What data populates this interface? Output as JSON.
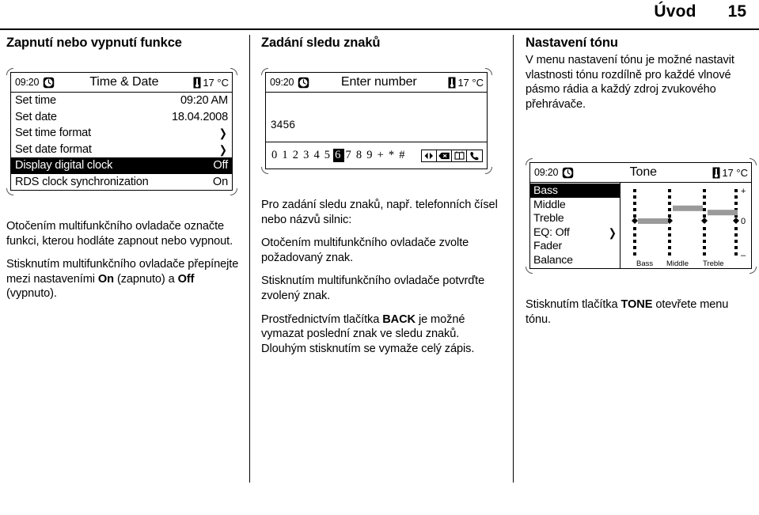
{
  "header": {
    "chapter": "Úvod",
    "page_number": "15"
  },
  "col1": {
    "title": "Zapnutí nebo vypnutí funkce",
    "display": {
      "clock": "09:20",
      "title": "Time & Date",
      "temperature": "17 °C",
      "clock_icon": "clock-icon",
      "thermometer_icon": "thermometer-icon",
      "rows": [
        {
          "label": "Set time",
          "value": "09:20 AM",
          "selected": false,
          "submenu": false
        },
        {
          "label": "Set date",
          "value": "18.04.2008",
          "selected": false,
          "submenu": false
        },
        {
          "label": "Set time format",
          "value": "",
          "selected": false,
          "submenu": true
        },
        {
          "label": "Set date format",
          "value": "",
          "selected": false,
          "submenu": true
        },
        {
          "label": "Display digital clock",
          "value": "Off",
          "selected": true,
          "submenu": false
        },
        {
          "label": "RDS clock synchronization",
          "value": "On",
          "selected": false,
          "submenu": false
        }
      ],
      "submenu_arrow": "❯"
    },
    "p1": "Otočením multifunkčního ovladače označte funkci, kterou hodláte zapnout nebo vypnout.",
    "p2_a": "Stisknutím multifunkčního ovladače přepínejte mezi nastaveními ",
    "p2_on": "On",
    "p2_b": " (zapnuto) a ",
    "p2_off": "Off",
    "p2_c": " (vypnuto)."
  },
  "col2": {
    "title": "Zadání sledu znaků",
    "display": {
      "clock": "09:20",
      "title": "Enter number",
      "temperature": "17 °C",
      "entry": "3456",
      "charset": [
        "0",
        "1",
        "2",
        "3",
        "4",
        "5",
        "6",
        "7",
        "8",
        "9",
        "+",
        "*",
        "#"
      ],
      "selected_char": "6",
      "icons": [
        "cursor-left-right-icon",
        "backspace-icon",
        "phonebook-icon",
        "call-icon"
      ]
    },
    "p1": "Pro zadání sledu znaků, např. telefonních čísel nebo názvů silnic:",
    "p2": "Otočením multifunkčního ovladače zvolte požadovaný znak.",
    "p3": "Stisknutím multifunkčního ovladače potvrďte zvolený znak.",
    "p4_a": "Prostřednictvím tlačítka ",
    "p4_back": "BACK",
    "p4_b": " je možné vymazat poslední znak ve sledu znaků. Dlouhým stisknutím se vymaže celý zápis."
  },
  "col3": {
    "title": "Nastavení tónu",
    "p1": "V menu nastavení tónu je možné nastavit vlastnosti tónu rozdílně pro každé vlnové pásmo rádia a každý zdroj zvukového přehrávače.",
    "display": {
      "clock": "09:20",
      "title": "Tone",
      "temperature": "17 °C",
      "menu": [
        {
          "label": "Bass",
          "value": "",
          "selected": true,
          "submenu": false
        },
        {
          "label": "Middle",
          "value": "",
          "selected": false,
          "submenu": false
        },
        {
          "label": "Treble",
          "value": "",
          "selected": false,
          "submenu": false
        },
        {
          "label": "EQ:  Off",
          "value": "",
          "selected": false,
          "submenu": true
        },
        {
          "label": "Fader",
          "value": "",
          "selected": false,
          "submenu": false
        },
        {
          "label": "Balance",
          "value": "",
          "selected": false,
          "submenu": false
        }
      ],
      "submenu_arrow": "❯",
      "graph": {
        "bar_labels": [
          "Bass",
          "Middle",
          "Treble"
        ],
        "scale_top": "+",
        "scale_mid": "0",
        "scale_bottom": "–"
      }
    },
    "p2_a": "Stisknutím tlačítka ",
    "p2_tone": "TONE",
    "p2_b": " otevřete menu tónu."
  },
  "chart_data": {
    "type": "bar",
    "title": "Tone",
    "categories": [
      "Bass",
      "Middle",
      "Treble"
    ],
    "values": [
      0,
      3,
      2
    ],
    "ylim": [
      -7,
      7
    ],
    "ylabel": "",
    "xlabel": "",
    "tick_labels": [
      "+",
      "0",
      "–"
    ],
    "grid": true,
    "legend": "none"
  }
}
